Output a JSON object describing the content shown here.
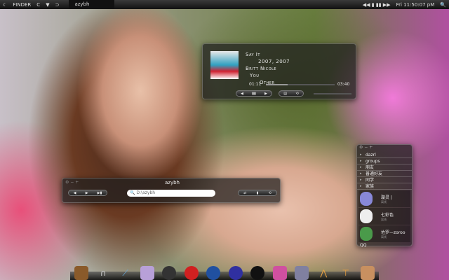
{
  "topbar": {
    "logo": "☾",
    "app": "FINDER",
    "menu1": "C",
    "menu2": "▼",
    "menu3": "⊃",
    "title": "azybh",
    "controls": "◀◀ ▮ ▮▮ ▶▶",
    "clock": "Fri 11:50:07 pM"
  },
  "player": {
    "title": "Say It",
    "year": "2007, 2007",
    "artist": "Britt Nicole",
    "album": "You",
    "genre": "Other",
    "elapsed": "01:11",
    "total": "03:40",
    "progress": 0.32
  },
  "finder": {
    "title": "azybh",
    "search_value": "D:\\azybh"
  },
  "qq": {
    "groups": [
      "dazrl",
      "groups",
      "朋友",
      "普通好友",
      "同学",
      "家族"
    ],
    "contacts": [
      {
        "name": "璇灵 |",
        "status": "离线"
      },
      {
        "name": "七彩色",
        "status": "离线"
      },
      {
        "name": "佐罗—zoroo",
        "status": "离线"
      }
    ],
    "footer": "QQ"
  },
  "dock": {
    "icons": [
      "finder-icon",
      "magnet-icon",
      "feather-icon",
      "photo-icon",
      "disc-icon",
      "qq-penguin-red-icon",
      "safari-icon",
      "firefox-icon",
      "qq-icon",
      "pink-app-icon",
      "video-icon",
      "pencil-icon",
      "sign-icon",
      "box-icon"
    ]
  }
}
